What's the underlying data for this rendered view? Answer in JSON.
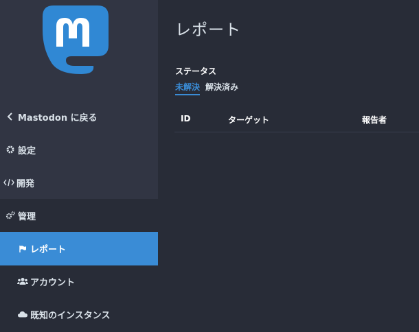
{
  "sidebar": {
    "back_label": "Mastodon に戻る",
    "items": [
      {
        "label": "設定",
        "icon": "gear-icon"
      },
      {
        "label": "開発",
        "icon": "code-icon"
      },
      {
        "label": "管理",
        "icon": "cogs-icon"
      }
    ],
    "admin_items": [
      {
        "label": "レポート",
        "icon": "flag-icon",
        "active": true
      },
      {
        "label": "アカウント",
        "icon": "users-icon"
      },
      {
        "label": "既知のインスタンス",
        "icon": "cloud-icon"
      }
    ]
  },
  "main": {
    "title": "レポート",
    "filter": {
      "label": "ステータス",
      "tabs": [
        {
          "label": "未解決",
          "active": true
        },
        {
          "label": "解決済み",
          "active": false
        }
      ]
    },
    "table": {
      "columns": [
        "ID",
        "ターゲット",
        "報告者"
      ]
    }
  },
  "colors": {
    "sidebar_bg": "#313543",
    "main_bg": "#282c37",
    "accent": "#3a8cd6",
    "logo": "#3088d4"
  }
}
